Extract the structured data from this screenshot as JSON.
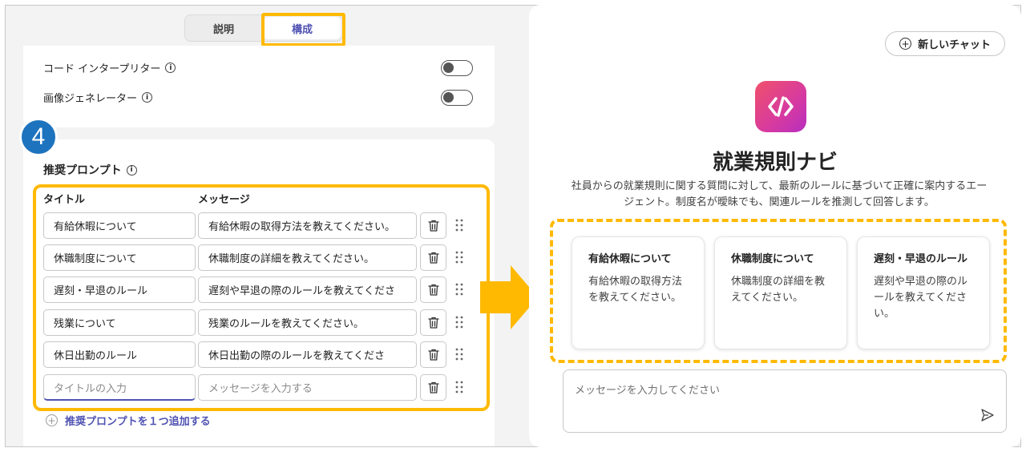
{
  "tabs": [
    {
      "label": "説明"
    },
    {
      "label": "構成"
    }
  ],
  "settings": [
    {
      "label": "コード インタープリター",
      "info_icon": "info-icon"
    },
    {
      "label": "画像ジェネレーター",
      "info_icon": "info-icon"
    }
  ],
  "step_badge": "4",
  "prompts_section": {
    "title": "推奨プロンプト",
    "col_title": "タイトル",
    "col_message": "メッセージ",
    "rows": [
      {
        "title": "有給休暇について",
        "message": "有給休暇の取得方法を教えてください。"
      },
      {
        "title": "休職制度について",
        "message": "休職制度の詳細を教えてください。"
      },
      {
        "title": "遅刻・早退のルール",
        "message": "遅刻や早退の際のルールを教えてくださ"
      },
      {
        "title": "残業について",
        "message": "残業のルールを教えてください。"
      },
      {
        "title": "休日出勤のルール",
        "message": "休日出勤の際のルールを教えてくださ"
      }
    ],
    "new_row": {
      "title_placeholder": "タイトルの入力",
      "message_placeholder": "メッセージを入力する"
    },
    "add_label": "推奨プロンプトを１つ追加する"
  },
  "preview": {
    "new_chat_label": "新しいチャット",
    "agent_name": "就業規則ナビ",
    "agent_description": "社員からの就業規則に関する質問に対して、最新のルールに基づいて正確に案内するエージェント。制度名が曖昧でも、関連ルールを推測して回答します。",
    "suggestions": [
      {
        "title": "有給休暇について",
        "message": "有給休暇の取得方法を教えてください。"
      },
      {
        "title": "休職制度について",
        "message": "休職制度の詳細を教えてください。"
      },
      {
        "title": "遅刻・早退のルール",
        "message": "遅刻や早退の際のルールを教えてください。"
      }
    ],
    "chat_placeholder": "メッセージを入力してください"
  },
  "colors": {
    "highlight": "#ffb900",
    "accent": "#4f52b2",
    "badge": "#1e73be"
  }
}
